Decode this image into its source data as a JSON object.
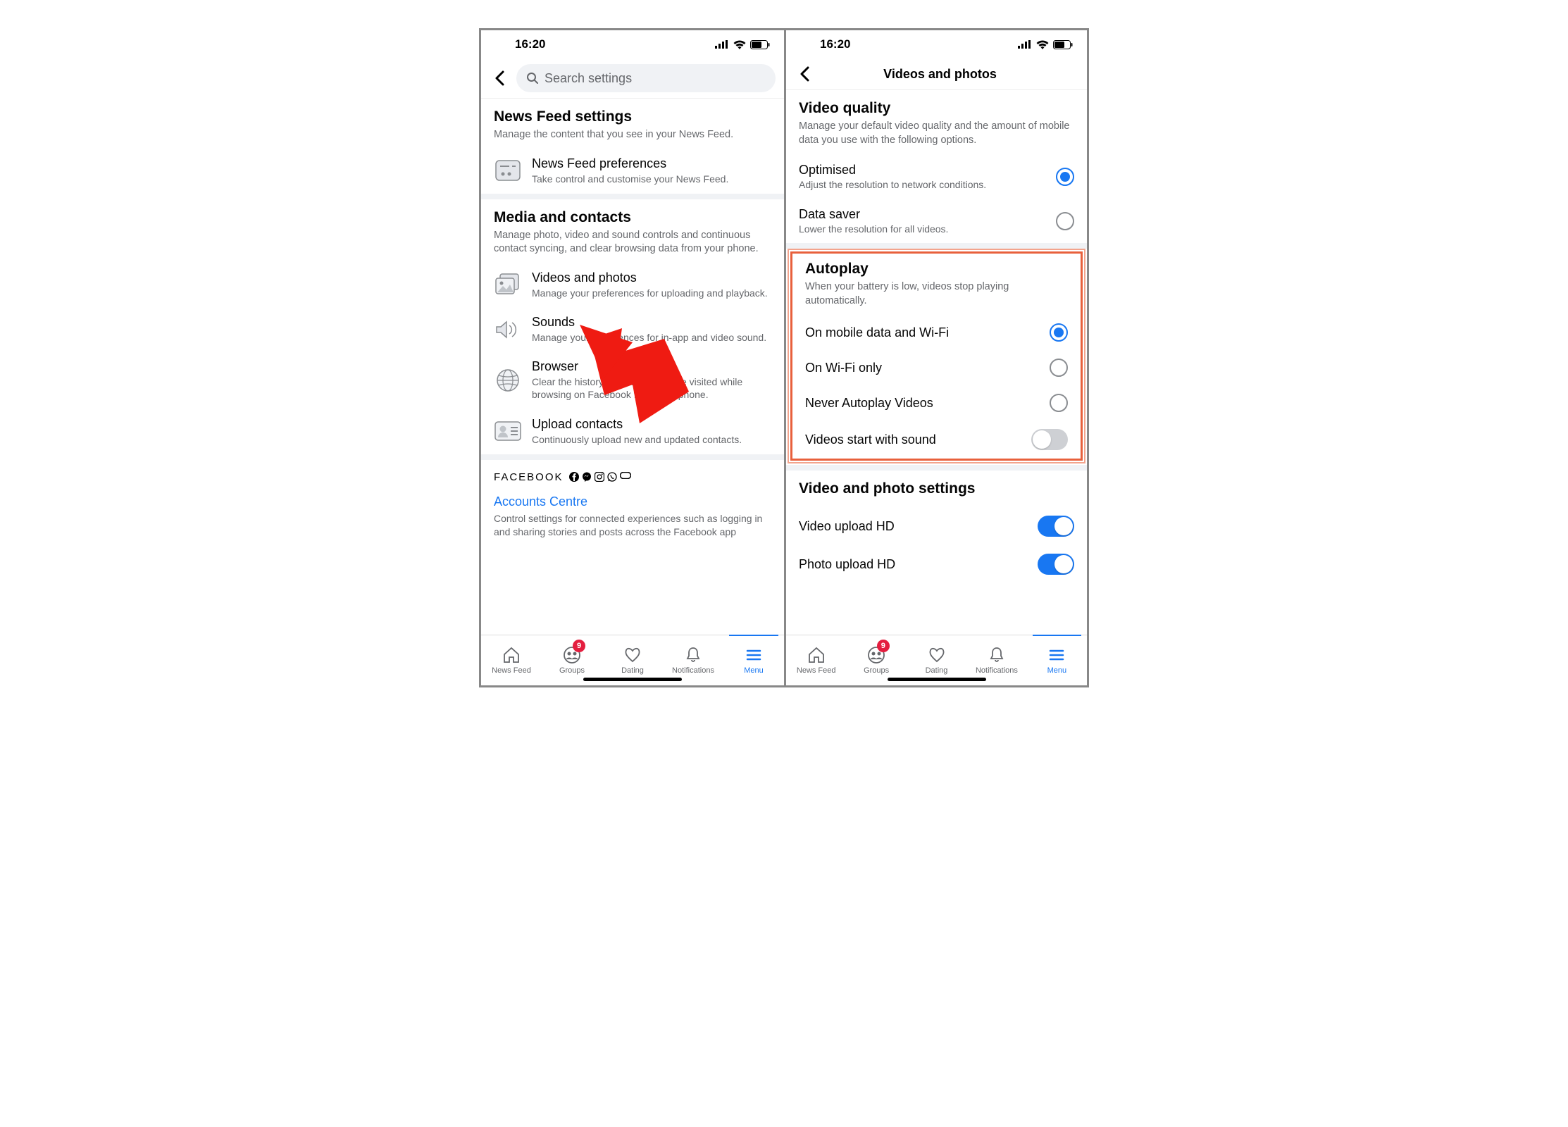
{
  "status": {
    "time": "16:20"
  },
  "left": {
    "search_placeholder": "Search settings",
    "sections": {
      "newsfeed": {
        "title": "News Feed settings",
        "desc": "Manage the content that you see in your News Feed.",
        "pref_title": "News Feed preferences",
        "pref_desc": "Take control and customise your News Feed."
      },
      "media": {
        "title": "Media and contacts",
        "desc": "Manage photo, video and sound controls and continuous contact syncing, and clear browsing data from your phone.",
        "videos_title": "Videos and photos",
        "videos_desc": "Manage your preferences for uploading and playback.",
        "sounds_title": "Sounds",
        "sounds_desc": "Manage your preferences for in-app and video sound.",
        "browser_title": "Browser",
        "browser_desc": "Clear the history of websites you've visited while browsing on Facebook from your phone.",
        "upload_title": "Upload contacts",
        "upload_desc": "Continuously upload new and updated contacts."
      },
      "footer": {
        "brand": "FACEBOOK",
        "accounts_title": "Accounts Centre",
        "accounts_desc": "Control settings for connected experiences such as logging in and sharing stories and posts across the Facebook app"
      }
    }
  },
  "right": {
    "title": "Videos and photos",
    "video_quality": {
      "title": "Video quality",
      "desc": "Manage your default video quality and the amount of mobile data you use with the following options.",
      "optimised_title": "Optimised",
      "optimised_desc": "Adjust the resolution to network conditions.",
      "datasaver_title": "Data saver",
      "datasaver_desc": "Lower the resolution for all videos."
    },
    "autoplay": {
      "title": "Autoplay",
      "desc": "When your battery is low, videos stop playing automatically.",
      "opt1": "On mobile data and Wi-Fi",
      "opt2": "On Wi-Fi only",
      "opt3": "Never Autoplay Videos",
      "sound_toggle": "Videos start with sound"
    },
    "vp_settings": {
      "title": "Video and photo settings",
      "video_hd": "Video upload HD",
      "photo_hd": "Photo upload HD"
    }
  },
  "tabs": {
    "newsfeed": "News Feed",
    "groups": "Groups",
    "groups_badge": "9",
    "dating": "Dating",
    "notifications": "Notifications",
    "menu": "Menu"
  }
}
